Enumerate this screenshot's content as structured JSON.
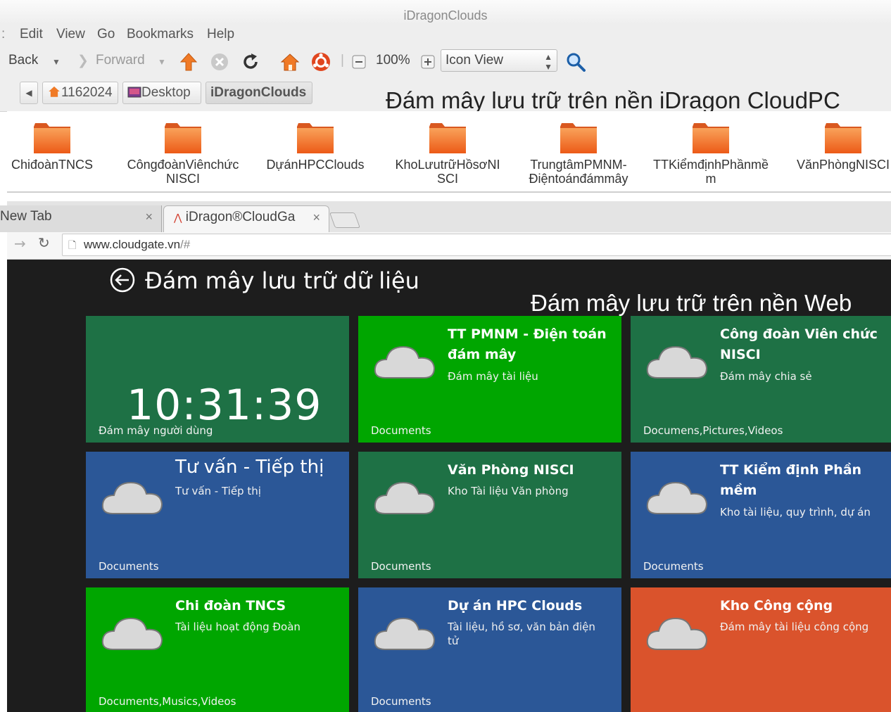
{
  "file_manager": {
    "window_title": "iDragonClouds",
    "menu": [
      "Edit",
      "View",
      "Go",
      "Bookmarks",
      "Help"
    ],
    "toolbar": {
      "back": "Back",
      "forward": "Forward",
      "zoom": "100%",
      "view_mode": "Icon View"
    },
    "breadcrumbs": [
      "1162024",
      "Desktop",
      "iDragonClouds"
    ],
    "annotation": "Đám mây lưu trữ trên nền iDragon CloudPC",
    "folders": [
      "ChiđoànTNCS",
      "CôngđoànViênchứcNISCI",
      "DựánHPCClouds",
      "KhoLưutrữHồsơNISCI",
      "TrungtâmPMNM-Điệntoánđámmây",
      "TTKiểmđịnhPhầnmềm",
      "VănPhòngNISCI"
    ]
  },
  "browser": {
    "tabs": [
      {
        "label": "New Tab"
      },
      {
        "label": "iDragon®CloudGa"
      }
    ],
    "url_host": "www.cloudgate.vn",
    "url_path": "/#",
    "page_title": "Đám mây lưu trữ dữ liệu",
    "annotation": "Đám mây lưu trữ trên nền Web",
    "clock_tile": {
      "time": "10:31:39",
      "label": "Đám mây người dùng"
    },
    "tiles": [
      {
        "name": "TT PMNM - Điện toán đám mây",
        "desc": "Đám mây tài liệu",
        "foot": "Documents",
        "color": "#00a600"
      },
      {
        "name": "Công đoàn Viên chức NISCI",
        "desc": "Đám mây chia sẻ",
        "foot": "Documens,Pictures,Videos",
        "color": "#1e7145"
      },
      {
        "name": "Tư vấn - Tiếp thị",
        "desc": "Tư vấn - Tiếp thị",
        "foot": "Documents",
        "color": "#2b5797"
      },
      {
        "name": "Văn Phòng NISCI",
        "desc": "Kho Tài liệu Văn phòng",
        "foot": "Documents",
        "color": "#1e7145"
      },
      {
        "name": "TT Kiểm định Phần mềm",
        "desc": "Kho tài liệu, quy trình, dự án",
        "foot": "Documents",
        "color": "#2b5797"
      },
      {
        "name": "Chi đoàn TNCS",
        "desc": "Tài liệu hoạt động Đoàn",
        "foot": "Documents,Musics,Videos",
        "color": "#00a600"
      },
      {
        "name": "Dự án HPC Clouds",
        "desc": "Tài liệu, hồ sơ, văn bản điện tử",
        "foot": "Documents",
        "color": "#2b5797"
      },
      {
        "name": "Kho Công cộng",
        "desc": "Đám mây tài liệu công cộng",
        "foot": "",
        "color": "#da532c"
      }
    ],
    "clock_color": "#1e7145"
  }
}
